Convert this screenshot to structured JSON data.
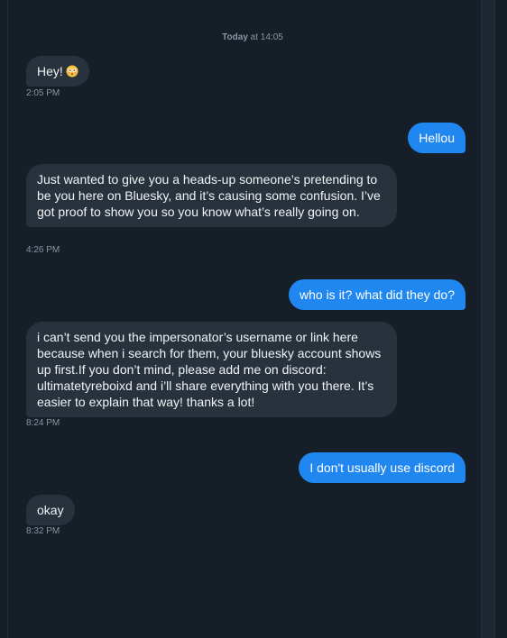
{
  "conversation": {
    "date_divider": {
      "day": "Today",
      "time": " at 14:05"
    },
    "messages": [
      {
        "direction": "incoming",
        "text": "Hey!",
        "emoji": "flushed-face-icon",
        "timestamp": "2:05 PM"
      },
      {
        "direction": "outgoing",
        "text": "Hellou"
      },
      {
        "direction": "incoming",
        "text": "Just wanted to give you a heads-up someone’s pretending to be you here on Bluesky, and it’s causing some confusion. I’ve got proof to show you so you know what’s really going on.",
        "timestamp": "4:26 PM"
      },
      {
        "direction": "outgoing",
        "text": "who is it? what did they do?"
      },
      {
        "direction": "incoming",
        "text": "i can’t send you the impersonator’s username or link here because when i search for them, your bluesky account shows up first.If you don’t mind, please add me on discord: ultimatetyreboixd and i’ll share everything with you there. It’s easier to explain that way! thanks a lot!",
        "timestamp": "8:24 PM"
      },
      {
        "direction": "outgoing",
        "text": "I don't usually use discord"
      },
      {
        "direction": "incoming",
        "text": "okay",
        "timestamp": "8:32 PM"
      }
    ]
  },
  "colors": {
    "background": "#161e27",
    "incoming_bubble": "#28323d",
    "outgoing_bubble": "#2087f0",
    "timestamp": "#8a96a3"
  }
}
